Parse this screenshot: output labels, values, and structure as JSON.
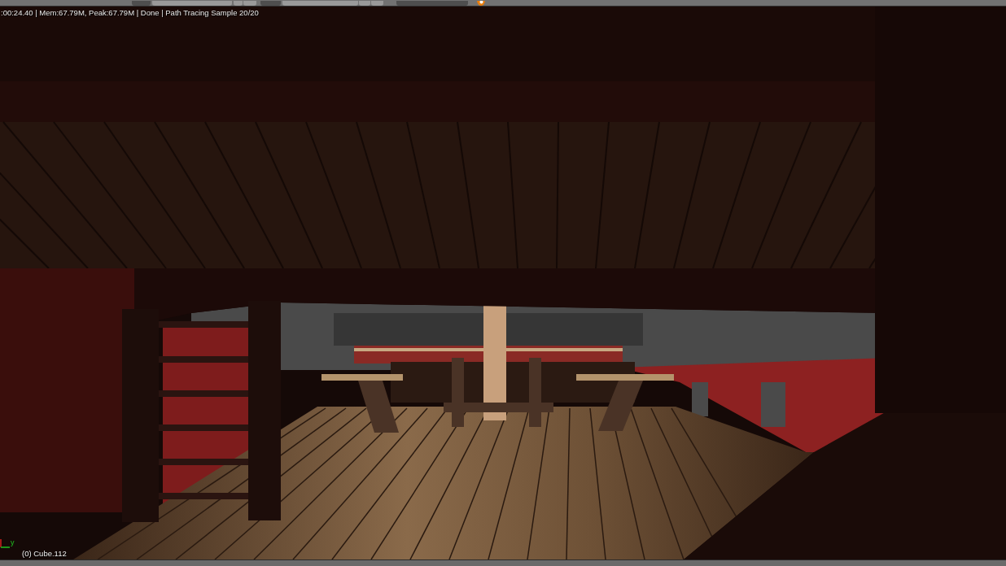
{
  "viewport": {
    "render_info": ":00:24.40 | Mem:67.79M, Peak:67.79M | Done | Path Tracing Sample 20/20",
    "axis_label": "y",
    "object_label": "(0) Cube.112"
  }
}
